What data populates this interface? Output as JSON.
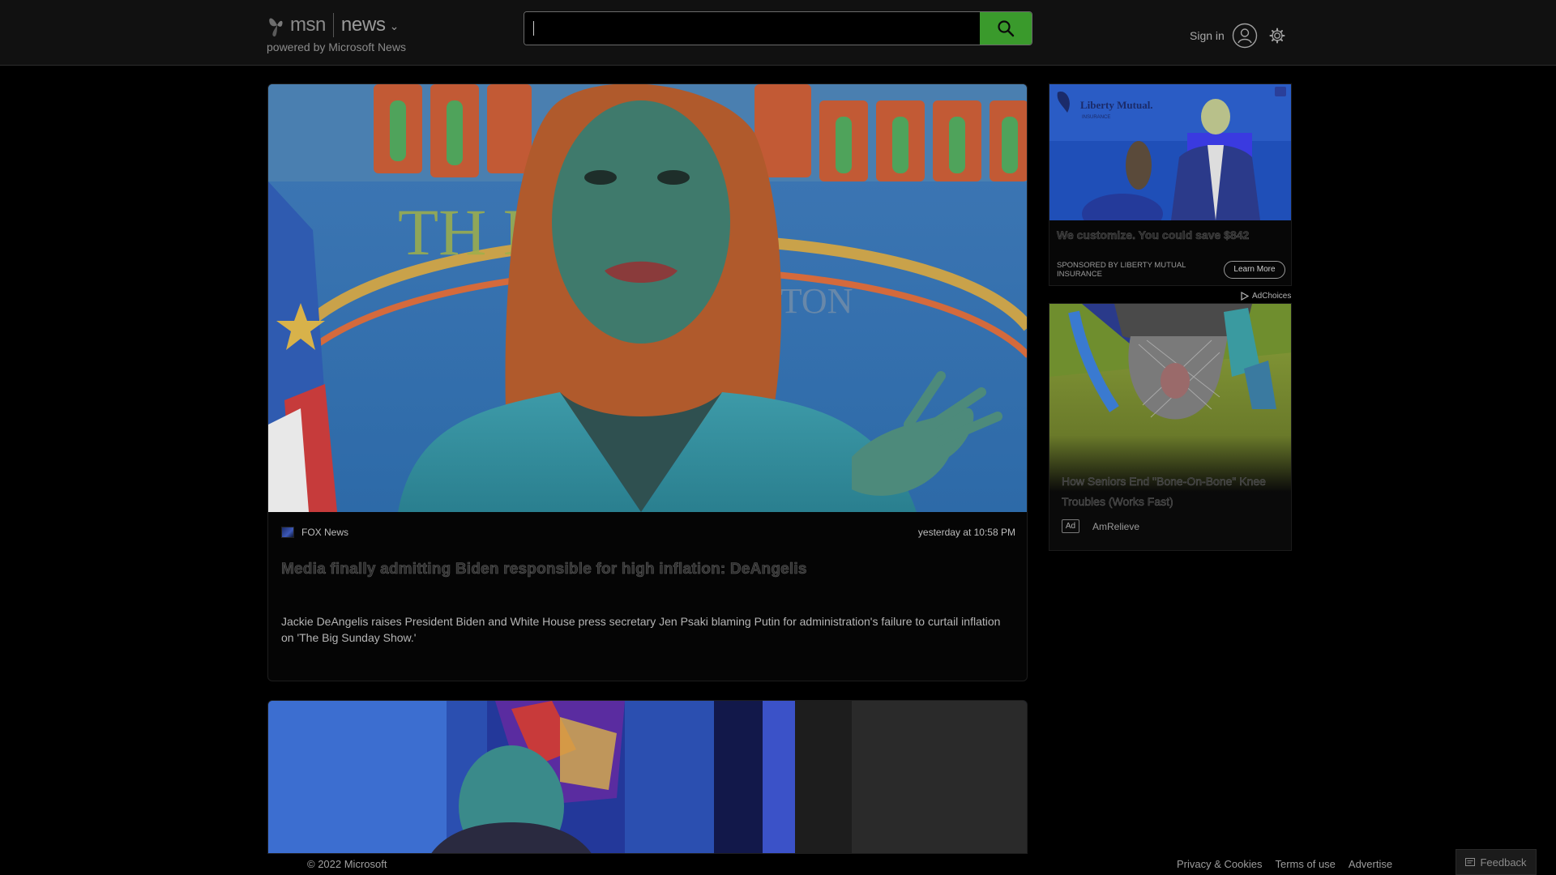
{
  "header": {
    "brand_msn": "msn",
    "brand_section": "news",
    "brand_tagline": "powered by Microsoft News",
    "search": {
      "placeholder": "",
      "value": ""
    },
    "signin_label": "Sign in",
    "accent_color": "#3a9a2c"
  },
  "main_article": {
    "source": "FOX News",
    "timestamp": "yesterday at 10:58 PM",
    "headline": "Media finally admitting Biden responsible for high inflation: DeAngelis",
    "summary": "Jackie DeAngelis raises President Biden and White House press secretary Jen Psaki blaming Putin for administration's failure to curtail inflation on 'The Big Sunday Show.'",
    "image_text": "THE HOUS"
  },
  "ads": {
    "ad1": {
      "brand_text": "Liberty Mutual.",
      "brand_sub": "INSURANCE",
      "title": "We customize. You could save $842",
      "sponsor": "SPONSORED BY LIBERTY MUTUAL INSURANCE",
      "cta": "Learn More"
    },
    "adchoices_label": "AdChoices",
    "ad2": {
      "title": "How Seniors End \"Bone-On-Bone\" Knee Troubles (Works Fast)",
      "ad_tag": "Ad",
      "brand": "AmRelieve"
    }
  },
  "footer": {
    "copyright": "© 2022 Microsoft",
    "links": [
      "Privacy & Cookies",
      "Terms of use",
      "Advertise"
    ],
    "feedback": "Feedback"
  }
}
